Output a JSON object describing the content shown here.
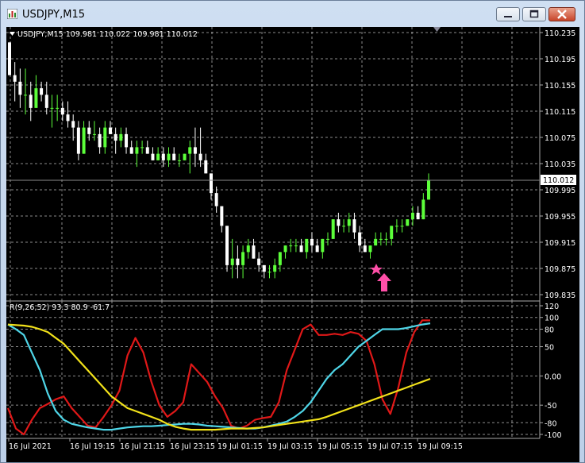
{
  "window": {
    "title": "USDJPY,M15"
  },
  "main_panel": {
    "header": "USDJPY,M15  109.981 110.022 109.981 110.012",
    "price_ticks": [
      "110.235",
      "110.195",
      "110.155",
      "110.115",
      "110.075",
      "110.035",
      "109.995",
      "109.955",
      "109.915",
      "109.875",
      "109.835"
    ],
    "current_price": "110.012"
  },
  "indicator_panel": {
    "header": "R(9,26,52) 93.3 80.9 -61.7",
    "ticks": [
      "120",
      "100",
      "80",
      "50",
      "0.00",
      "-50",
      "-80",
      "-100"
    ]
  },
  "time_axis": [
    "16 Jul 2021",
    "16 Jul 19:15",
    "16 Jul 21:15",
    "16 Jul 23:15",
    "19 Jul 01:15",
    "19 Jul 03:15",
    "19 Jul 05:15",
    "19 Jul 07:15",
    "19 Jul 09:15"
  ],
  "colors": {
    "background": "#000000",
    "grid": "#c8c8c8",
    "bull_candle": "#5cff3a",
    "bear_candle": "#ffffff",
    "line_red": "#e01818",
    "line_cyan": "#4fd6e8",
    "line_yellow": "#f2e21a",
    "signal": "#ff4fa8",
    "text": "#ffffff"
  },
  "signals": [
    "star-icon",
    "up-arrow-icon"
  ],
  "chart_data": {
    "type": "candlestick",
    "price_range": [
      109.835,
      110.235
    ],
    "candles": [
      [
        110.22,
        110.22,
        110.17,
        110.17
      ],
      [
        110.17,
        110.19,
        110.13,
        110.16
      ],
      [
        110.16,
        110.18,
        110.12,
        110.14
      ],
      [
        110.14,
        110.18,
        110.11,
        110.14
      ],
      [
        110.14,
        110.16,
        110.1,
        110.12
      ],
      [
        110.12,
        110.17,
        110.12,
        110.15
      ],
      [
        110.15,
        110.16,
        110.13,
        110.14
      ],
      [
        110.14,
        110.16,
        110.11,
        110.12
      ],
      [
        110.12,
        110.14,
        110.09,
        110.12
      ],
      [
        110.12,
        110.14,
        110.1,
        110.12
      ],
      [
        110.12,
        110.13,
        110.1,
        110.11
      ],
      [
        110.11,
        110.13,
        110.09,
        110.1
      ],
      [
        110.1,
        110.11,
        110.07,
        110.09
      ],
      [
        110.09,
        110.1,
        110.04,
        110.05
      ],
      [
        110.05,
        110.1,
        110.05,
        110.09
      ],
      [
        110.09,
        110.1,
        110.07,
        110.08
      ],
      [
        110.08,
        110.1,
        110.07,
        110.08
      ],
      [
        110.08,
        110.09,
        110.05,
        110.06
      ],
      [
        110.06,
        110.1,
        110.05,
        110.09
      ],
      [
        110.09,
        110.1,
        110.08,
        110.08
      ],
      [
        110.08,
        110.09,
        110.05,
        110.07
      ],
      [
        110.07,
        110.09,
        110.06,
        110.08
      ],
      [
        110.08,
        110.09,
        110.05,
        110.06
      ],
      [
        110.06,
        110.07,
        110.05,
        110.05
      ],
      [
        110.05,
        110.07,
        110.03,
        110.06
      ],
      [
        110.06,
        110.07,
        110.05,
        110.06
      ],
      [
        110.06,
        110.07,
        110.05,
        110.05
      ],
      [
        110.05,
        110.06,
        110.04,
        110.04
      ],
      [
        110.04,
        110.06,
        110.04,
        110.05
      ],
      [
        110.05,
        110.06,
        110.03,
        110.04
      ],
      [
        110.04,
        110.06,
        110.03,
        110.05
      ],
      [
        110.05,
        110.06,
        110.04,
        110.04
      ],
      [
        110.04,
        110.05,
        110.03,
        110.04
      ],
      [
        110.04,
        110.05,
        110.04,
        110.05
      ],
      [
        110.05,
        110.07,
        110.02,
        110.06
      ],
      [
        110.06,
        110.09,
        110.03,
        110.05
      ],
      [
        110.05,
        110.09,
        110.03,
        110.04
      ],
      [
        110.04,
        110.05,
        110.02,
        110.02
      ],
      [
        110.02,
        110.02,
        109.98,
        109.99
      ],
      [
        109.99,
        110.0,
        109.96,
        109.97
      ],
      [
        109.97,
        109.97,
        109.93,
        109.94
      ],
      [
        109.94,
        109.94,
        109.87,
        109.88
      ],
      [
        109.88,
        109.92,
        109.86,
        109.89
      ],
      [
        109.89,
        109.91,
        109.86,
        109.88
      ],
      [
        109.88,
        109.91,
        109.86,
        109.9
      ],
      [
        109.9,
        109.92,
        109.89,
        109.91
      ],
      [
        109.91,
        109.92,
        109.89,
        109.89
      ],
      [
        109.89,
        109.9,
        109.87,
        109.88
      ],
      [
        109.88,
        109.88,
        109.86,
        109.87
      ],
      [
        109.87,
        109.88,
        109.86,
        109.87
      ],
      [
        109.87,
        109.89,
        109.86,
        109.88
      ],
      [
        109.88,
        109.9,
        109.87,
        109.9
      ],
      [
        109.9,
        109.91,
        109.89,
        109.91
      ],
      [
        109.91,
        109.92,
        109.9,
        109.91
      ],
      [
        109.91,
        109.92,
        109.9,
        109.91
      ],
      [
        109.91,
        109.92,
        109.9,
        109.9
      ],
      [
        109.9,
        109.92,
        109.89,
        109.92
      ],
      [
        109.92,
        109.93,
        109.9,
        109.91
      ],
      [
        109.91,
        109.92,
        109.9,
        109.9
      ],
      [
        109.9,
        109.92,
        109.89,
        109.92
      ],
      [
        109.92,
        109.93,
        109.91,
        109.92
      ],
      [
        109.92,
        109.95,
        109.92,
        109.95
      ],
      [
        109.95,
        109.96,
        109.93,
        109.94
      ],
      [
        109.94,
        109.95,
        109.93,
        109.94
      ],
      [
        109.94,
        109.96,
        109.93,
        109.95
      ],
      [
        109.95,
        109.96,
        109.92,
        109.93
      ],
      [
        109.93,
        109.94,
        109.9,
        109.91
      ],
      [
        109.91,
        109.92,
        109.9,
        109.9
      ],
      [
        109.9,
        109.91,
        109.89,
        109.91
      ],
      [
        109.91,
        109.93,
        109.91,
        109.92
      ],
      [
        109.92,
        109.93,
        109.91,
        109.92
      ],
      [
        109.92,
        109.93,
        109.91,
        109.92
      ],
      [
        109.92,
        109.94,
        109.91,
        109.94
      ],
      [
        109.94,
        109.95,
        109.93,
        109.94
      ],
      [
        109.94,
        109.95,
        109.93,
        109.94
      ],
      [
        109.94,
        109.95,
        109.94,
        109.95
      ],
      [
        109.95,
        109.97,
        109.94,
        109.96
      ],
      [
        109.96,
        109.97,
        109.95,
        109.95
      ],
      [
        109.95,
        109.99,
        109.95,
        109.98
      ],
      [
        109.98,
        110.02,
        109.98,
        110.01
      ]
    ],
    "indicator": {
      "range": [
        -100,
        120
      ],
      "series": [
        {
          "color": "#e01818",
          "values": [
            -55,
            -90,
            -100,
            -75,
            -55,
            -48,
            -40,
            -35,
            -55,
            -70,
            -85,
            -88,
            -70,
            -50,
            -25,
            35,
            65,
            40,
            -10,
            -50,
            -70,
            -60,
            -45,
            20,
            5,
            -10,
            -35,
            -55,
            -85,
            -90,
            -85,
            -75,
            -72,
            -70,
            -45,
            10,
            45,
            80,
            88,
            70,
            70,
            72,
            70,
            75,
            72,
            60,
            20,
            -40,
            -65,
            -20,
            40,
            75,
            95,
            95
          ]
        },
        {
          "color": "#4fd6e8",
          "values": [
            88,
            80,
            70,
            40,
            10,
            -30,
            -60,
            -75,
            -82,
            -85,
            -88,
            -90,
            -92,
            -92,
            -90,
            -88,
            -87,
            -86,
            -86,
            -85,
            -84,
            -83,
            -82,
            -82,
            -83,
            -85,
            -86,
            -87,
            -88,
            -89,
            -90,
            -90,
            -88,
            -85,
            -82,
            -78,
            -70,
            -60,
            -45,
            -25,
            -5,
            10,
            20,
            35,
            50,
            60,
            70,
            80,
            80,
            80,
            82,
            85,
            88,
            90
          ]
        },
        {
          "color": "#f2e21a",
          "values": [
            88,
            87,
            86,
            84,
            80,
            75,
            65,
            55,
            40,
            25,
            10,
            -5,
            -20,
            -35,
            -45,
            -55,
            -60,
            -65,
            -70,
            -75,
            -82,
            -87,
            -90,
            -92,
            -92,
            -92,
            -92,
            -91,
            -90,
            -90,
            -90,
            -89,
            -88,
            -86,
            -84,
            -82,
            -80,
            -78,
            -76,
            -74,
            -70,
            -65,
            -60,
            -55,
            -50,
            -45,
            -40,
            -35,
            -30,
            -25,
            -20,
            -15,
            -10,
            -5
          ]
        }
      ]
    }
  }
}
